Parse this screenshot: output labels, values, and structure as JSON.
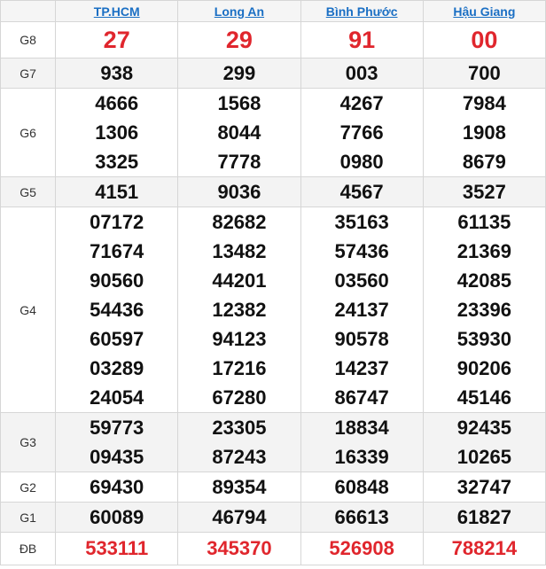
{
  "provinces": [
    "TP.HCM",
    "Long An",
    "Bình Phước",
    "Hậu Giang"
  ],
  "prizes": {
    "g8": {
      "label": "G8",
      "values": [
        "27",
        "29",
        "91",
        "00"
      ]
    },
    "g7": {
      "label": "G7",
      "values": [
        "938",
        "299",
        "003",
        "700"
      ]
    },
    "g6": {
      "label": "G6",
      "values": [
        [
          "4666",
          "1306",
          "3325"
        ],
        [
          "1568",
          "8044",
          "7778"
        ],
        [
          "4267",
          "7766",
          "0980"
        ],
        [
          "7984",
          "1908",
          "8679"
        ]
      ]
    },
    "g5": {
      "label": "G5",
      "values": [
        "4151",
        "9036",
        "4567",
        "3527"
      ]
    },
    "g4": {
      "label": "G4",
      "values": [
        [
          "07172",
          "71674",
          "90560",
          "54436",
          "60597",
          "03289",
          "24054"
        ],
        [
          "82682",
          "13482",
          "44201",
          "12382",
          "94123",
          "17216",
          "67280"
        ],
        [
          "35163",
          "57436",
          "03560",
          "24137",
          "90578",
          "14237",
          "86747"
        ],
        [
          "61135",
          "21369",
          "42085",
          "23396",
          "53930",
          "90206",
          "45146"
        ]
      ]
    },
    "g3": {
      "label": "G3",
      "values": [
        [
          "59773",
          "09435"
        ],
        [
          "23305",
          "87243"
        ],
        [
          "18834",
          "16339"
        ],
        [
          "92435",
          "10265"
        ]
      ]
    },
    "g2": {
      "label": "G2",
      "values": [
        "69430",
        "89354",
        "60848",
        "32747"
      ]
    },
    "g1": {
      "label": "G1",
      "values": [
        "60089",
        "46794",
        "66613",
        "61827"
      ]
    },
    "db": {
      "label": "ĐB",
      "values": [
        "533111",
        "345370",
        "526908",
        "788214"
      ]
    }
  },
  "colors": {
    "special": "#e0262d",
    "link": "#1a6fc4",
    "alt_row": "#f3f3f3"
  }
}
